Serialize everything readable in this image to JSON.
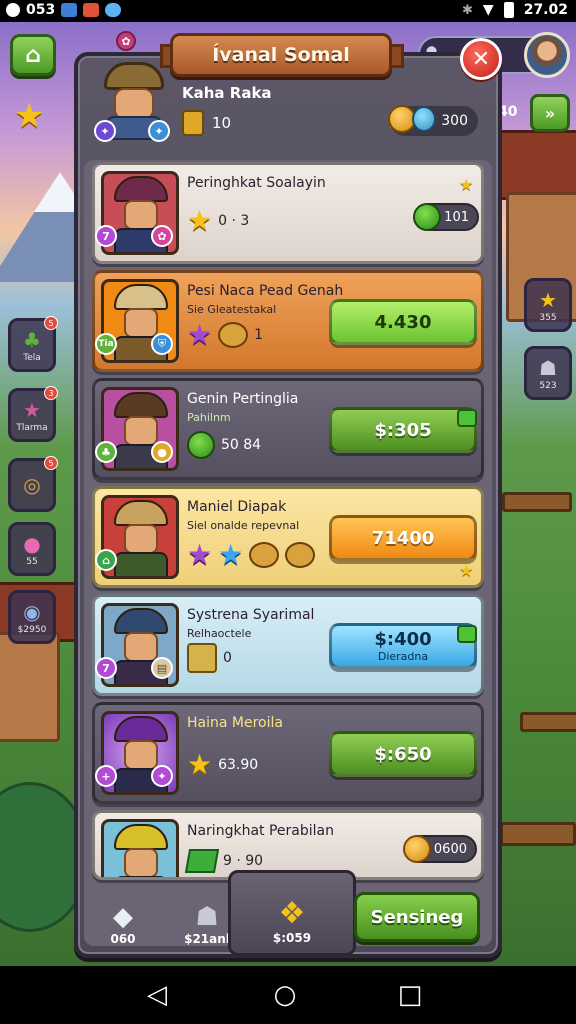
{
  "status_bar": {
    "left_text": "053",
    "time": "27.02"
  },
  "panel": {
    "title": "Ívanal Somal",
    "header": {
      "name": "Kaha Raka",
      "stat_value": "10",
      "coins": "300"
    },
    "items": [
      {
        "name": "Peringhkat Soalayin",
        "subtitle": "",
        "stats": "0 · 3",
        "price_label": "101",
        "price_sub": "",
        "badge_left": "7",
        "style": "pill"
      },
      {
        "name": "Pesi Naca Pead Genah",
        "subtitle": "Sie Gleatestakal",
        "stats": "1",
        "price_label": "4.430",
        "price_sub": "",
        "badge_left": "Tia",
        "style": "green-lite"
      },
      {
        "name": "Genin Pertinglia",
        "subtitle": "Pahilnm",
        "stats": "50 84",
        "price_label": "$:305",
        "price_sub": "",
        "badge_left": "",
        "style": "green"
      },
      {
        "name": "Maniel Diapak",
        "subtitle": "Siel onalde repevnal",
        "stats": "",
        "price_label": "71400",
        "price_sub": "",
        "badge_left": "",
        "style": "orange"
      },
      {
        "name": "Systrena Syarimal",
        "subtitle": "Relhaoctele",
        "stats": "0",
        "price_label": "$:400",
        "price_sub": "Dieradna",
        "badge_left": "7",
        "style": "blue"
      },
      {
        "name": "Haina Meroila",
        "subtitle": "",
        "stats": "63.90",
        "price_label": "$:650",
        "price_sub": "",
        "badge_left": "",
        "style": "green"
      },
      {
        "name": "Naringkhat Perabilan",
        "subtitle": "",
        "stats": "9 · 90",
        "price_label": "0600",
        "price_sub": "",
        "badge_left": "",
        "style": "pill"
      }
    ]
  },
  "side_left": [
    {
      "label": "Tela",
      "icon": "bush-icon",
      "dot": "5"
    },
    {
      "label": "Tlarma",
      "icon": "star-icon",
      "dot": "3"
    },
    {
      "label": "",
      "icon": "shield-icon",
      "dot": "5"
    },
    {
      "label": "55",
      "icon": "blob-icon",
      "dot": ""
    },
    {
      "label": "$2950",
      "icon": "disc-icon",
      "dot": ""
    }
  ],
  "side_right": [
    {
      "label": "355",
      "icon": "star-icon"
    },
    {
      "label": "523",
      "icon": "robot-icon"
    }
  ],
  "top_right": {
    "score_prefix": "40"
  },
  "bottom_tabs": {
    "tab1_label": "060",
    "tab2_label": "$21anl",
    "tab3_label": "$:059",
    "action_label": "Sensineg"
  },
  "colors": {
    "panel": "#4d4857",
    "accent_green": "#6ac431",
    "accent_orange": "#f08a14",
    "accent_blue": "#39a9e6",
    "close_red": "#c4201a"
  }
}
